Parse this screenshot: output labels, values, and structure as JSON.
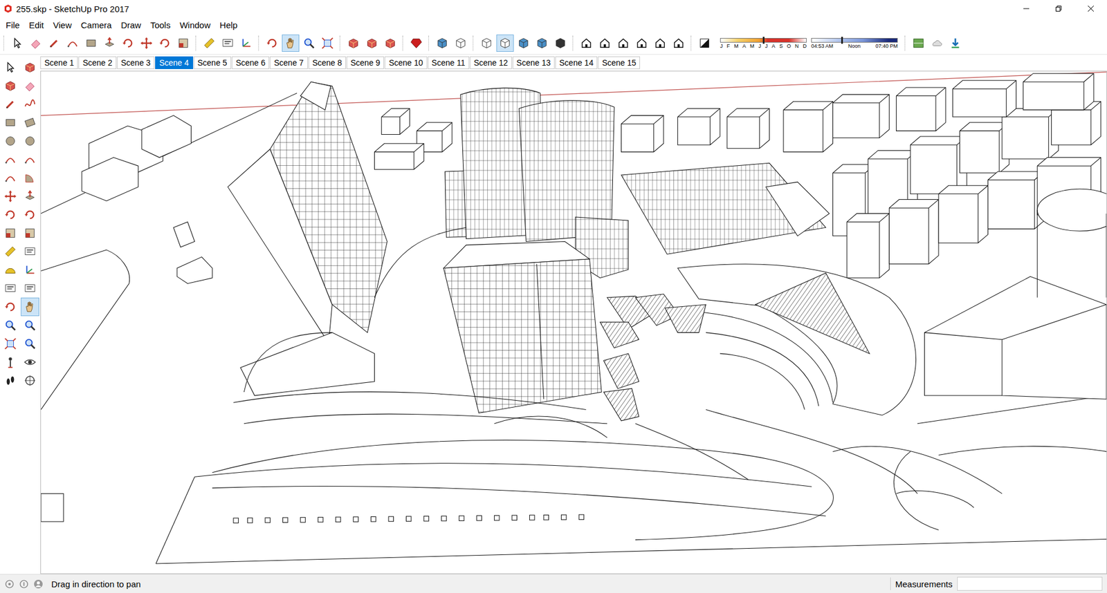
{
  "window": {
    "title": "255.skp - SketchUp Pro 2017"
  },
  "menu": [
    "File",
    "Edit",
    "View",
    "Camera",
    "Draw",
    "Tools",
    "Window",
    "Help"
  ],
  "toolbar": {
    "groups": [
      [
        {
          "selected": false
        },
        {
          "selected": false
        },
        {
          "selected": false
        },
        {
          "selected": false
        },
        {
          "selected": false
        },
        {
          "selected": false
        },
        {
          "selected": false
        },
        {
          "selected": false
        },
        {
          "selected": false
        },
        {
          "selected": false
        }
      ],
      [
        {
          "selected": false
        },
        {
          "selected": false
        },
        {
          "selected": false
        }
      ],
      [
        {
          "selected": false
        },
        {
          "selected": true
        },
        {
          "selected": false
        },
        {
          "selected": false
        }
      ],
      [
        {
          "selected": false
        },
        {
          "selected": false
        },
        {
          "selected": false
        }
      ],
      [
        {
          "selected": false
        }
      ],
      [
        {
          "selected": false
        },
        {
          "selected": false
        }
      ],
      [
        {
          "selected": false
        },
        {
          "selected": true
        },
        {
          "selected": false
        },
        {
          "selected": false
        },
        {
          "selected": false
        }
      ],
      [
        {
          "selected": false
        },
        {
          "selected": false
        },
        {
          "selected": false
        },
        {
          "selected": false
        },
        {
          "selected": false
        },
        {
          "selected": false
        }
      ],
      [
        {
          "selected": false
        }
      ],
      [
        {
          "selected": false
        },
        {
          "selected": false
        },
        {
          "selected": false
        }
      ]
    ]
  },
  "shadows": {
    "months": [
      "J",
      "F",
      "M",
      "A",
      "M",
      "J",
      "J",
      "A",
      "S",
      "O",
      "N",
      "D"
    ],
    "month_level": 0.5,
    "times": [
      "04:53 AM",
      "Noon",
      "07:40 PM"
    ],
    "time_level": 0.35
  },
  "scenes": [
    {
      "label": "Scene 1",
      "selected": false
    },
    {
      "label": "Scene 2",
      "selected": false
    },
    {
      "label": "Scene 3",
      "selected": false
    },
    {
      "label": "Scene 4",
      "selected": true
    },
    {
      "label": "Scene 5",
      "selected": false
    },
    {
      "label": "Scene 6",
      "selected": false
    },
    {
      "label": "Scene 7",
      "selected": false
    },
    {
      "label": "Scene 8",
      "selected": false
    },
    {
      "label": "Scene 9",
      "selected": false
    },
    {
      "label": "Scene 10",
      "selected": false
    },
    {
      "label": "Scene 11",
      "selected": false
    },
    {
      "label": "Scene 12",
      "selected": false
    },
    {
      "label": "Scene 13",
      "selected": false
    },
    {
      "label": "Scene 14",
      "selected": false
    },
    {
      "label": "Scene 15",
      "selected": false
    }
  ],
  "side_tools": [
    {
      "selected": false
    },
    {
      "selected": false
    },
    {
      "selected": false
    },
    {
      "selected": false
    },
    {
      "selected": false
    },
    {
      "selected": false
    },
    {
      "selected": false
    },
    {
      "selected": false
    },
    {
      "selected": false
    },
    {
      "selected": false
    },
    {
      "selected": false
    },
    {
      "selected": false
    },
    {
      "selected": false
    },
    {
      "selected": false
    },
    {
      "selected": false
    },
    {
      "selected": false
    },
    {
      "selected": false
    },
    {
      "selected": false
    },
    {
      "selected": false
    },
    {
      "selected": false
    },
    {
      "selected": false
    },
    {
      "selected": false
    },
    {
      "selected": false
    },
    {
      "selected": false
    },
    {
      "selected": false
    },
    {
      "selected": false
    },
    {
      "selected": false
    },
    {
      "selected": true
    },
    {
      "selected": false
    },
    {
      "selected": false
    },
    {
      "selected": false
    },
    {
      "selected": false
    },
    {
      "selected": false
    },
    {
      "selected": false
    },
    {
      "selected": false
    },
    {
      "selected": false
    }
  ],
  "status_bar": {
    "hint": "Drag in direction to pan",
    "measurements_label": "Measurements",
    "measurements_value": ""
  }
}
